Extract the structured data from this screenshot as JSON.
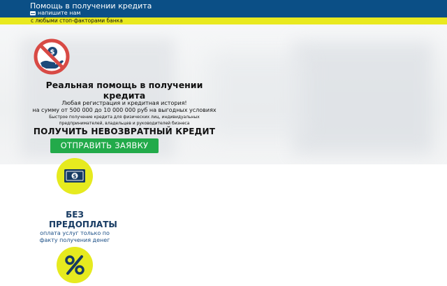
{
  "header": {
    "title": "Помощь в получении кредита",
    "contact_label": "напишите нам",
    "tagline": "с любыми стоп-факторами банка"
  },
  "hero": {
    "headline": "Реальная помощь в получении кредита",
    "subtitle_line1": "Любая регистрация и кредитная история!",
    "subtitle_line2": "на сумму от 500 000 до 10 000 000 руб на выгодных условиях",
    "small_text": "Быстрое получение кредита для физических лиц, индивидуальных предпринимателей, владельцев и руководителей бизнеса",
    "big_text": "ПОЛУЧИТЬ НЕВОЗВРАТНЫЙ КРЕДИТ",
    "cta_label": "ОТПРАВИТЬ ЗАЯВКУ",
    "icon": "no-money-icon"
  },
  "features": [
    {
      "icon": "money-icon",
      "title": "БЕЗ ПРЕДОПЛАТЫ",
      "description": "оплата услуг только по факту получения денег"
    },
    {
      "icon": "percent-icon"
    }
  ],
  "colors": {
    "topbar": "#0b4f86",
    "accent_yellow": "#e9e91f",
    "cta_green": "#22aa4a",
    "feature_title": "#163a62",
    "feature_desc": "#1b4f86",
    "icon_red": "#d84a45"
  }
}
